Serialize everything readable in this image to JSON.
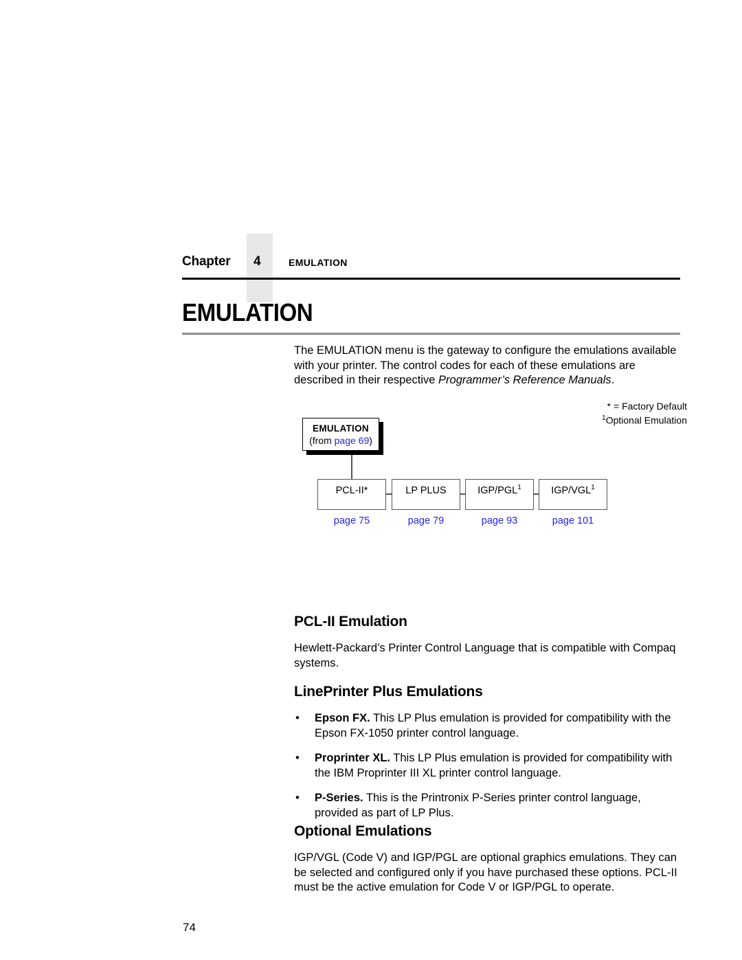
{
  "header": {
    "chapter_word": "Chapter",
    "chapter_number": "4",
    "running_title": "EMULATION"
  },
  "chapter_title": "EMULATION",
  "intro": {
    "text_before_italic": "The EMULATION menu is the gateway to configure the emulations available with your printer. The control codes for each of these emulations are described in their respective ",
    "italic_text": "Programmer’s Reference Manuals",
    "text_after_italic": "."
  },
  "diagram": {
    "legend": {
      "factory_default": "* = Factory Default",
      "optional_marker": "1",
      "optional_emulation": "Optional Emulation"
    },
    "root": {
      "title": "EMULATION",
      "from_prefix": "(from ",
      "from_link": "page 69",
      "from_suffix": ")"
    },
    "children": [
      {
        "label": "PCL-II*",
        "sup": "",
        "page": "page 75"
      },
      {
        "label": "LP PLUS",
        "sup": "",
        "page": "page 79"
      },
      {
        "label": "IGP/PGL",
        "sup": "1",
        "page": "page 93"
      },
      {
        "label": "IGP/VGL",
        "sup": "1",
        "page": "page 101"
      }
    ],
    "link_color": "#2424e6"
  },
  "sections": {
    "pcl": {
      "heading": "PCL-II Emulation",
      "body": "Hewlett-Packard’s Printer Control Language that is compatible with Compaq systems."
    },
    "lineprinter": {
      "heading": "LinePrinter Plus Emulations",
      "bullets": [
        {
          "bullet": "•",
          "term": "Epson FX.",
          "text": " This LP Plus emulation is provided for compatibility with the Epson FX-1050 printer control language."
        },
        {
          "bullet": "•",
          "term": "Proprinter XL.",
          "text": " This LP Plus emulation is provided for compatibility with the IBM Proprinter III XL printer control language."
        },
        {
          "bullet": "•",
          "term": "P-Series.",
          "text": " This is the Printronix P-Series printer control language, provided as part of LP Plus."
        }
      ]
    },
    "optional": {
      "heading": "Optional Emulations",
      "body": "IGP/VGL (Code V) and IGP/PGL are optional graphics emulations. They can be selected and configured only if you have purchased these options. PCL-II must be the active emulation for Code V or IGP/PGL to operate."
    }
  },
  "folio": "74"
}
